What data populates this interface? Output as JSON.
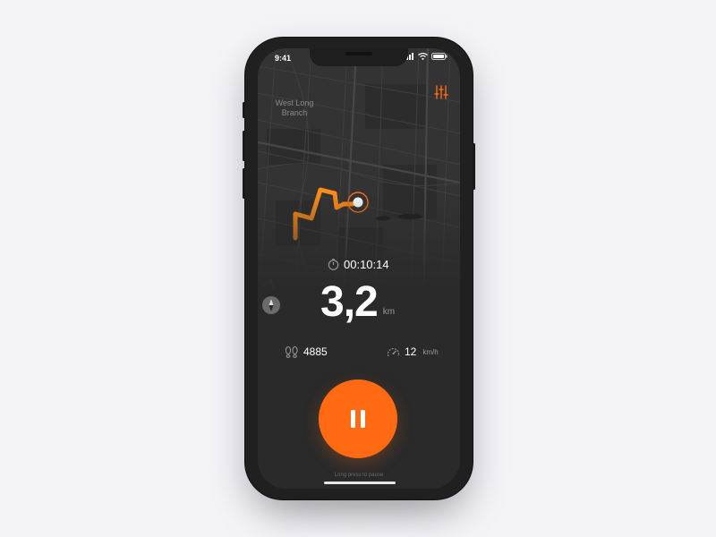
{
  "status_bar": {
    "time": "9:41"
  },
  "map": {
    "place_label": "West Long Branch",
    "route_color": "#ff8c1a"
  },
  "run": {
    "timer": "00:10:14",
    "distance_value": "3,2",
    "distance_unit": "km",
    "steps": "4885",
    "speed_value": "12",
    "speed_unit": "km/h"
  },
  "controls": {
    "pause_hint": "Long press to pause"
  },
  "icons": {
    "settings": "sliders-icon",
    "compass": "compass-icon",
    "timer": "stopwatch-icon",
    "steps": "footprints-icon",
    "speed": "speedometer-icon",
    "pause": "pause-icon"
  },
  "colors": {
    "accent": "#ff6a13",
    "background": "#2a2a2a"
  }
}
